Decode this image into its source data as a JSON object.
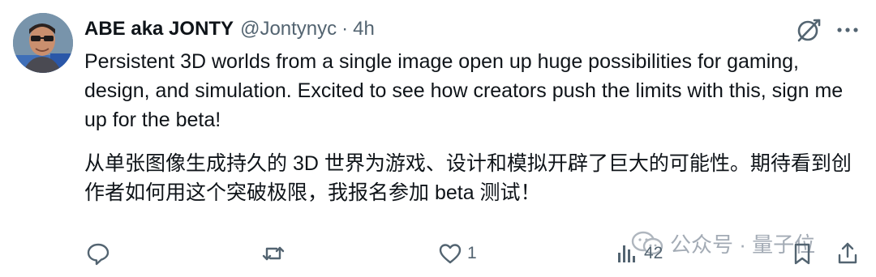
{
  "tweet": {
    "display_name": "ABE aka JONTY",
    "handle": "@Jontynyc",
    "separator": "·",
    "time": "4h",
    "text_en": "Persistent 3D worlds from a single image open up huge possibilities for gaming, design, and simulation. Excited to see how creators push the limits with this, sign me up for the beta!",
    "text_cn": "从单张图像生成持久的 3D 世界为游戏、设计和模拟开辟了巨大的可能性。期待看到创作者如何用这个突破极限，我报名参加 beta 测试！"
  },
  "actions": {
    "reply_count": "",
    "retweet_count": "",
    "like_count": "1",
    "views_count": "42"
  },
  "watermark": {
    "text": "公众号 · 量子位"
  },
  "icons": {
    "grok": "grok-icon",
    "more": "more-icon",
    "reply": "reply-icon",
    "retweet": "retweet-icon",
    "like": "heart-icon",
    "views": "views-icon",
    "bookmark": "bookmark-icon",
    "share": "share-icon"
  }
}
